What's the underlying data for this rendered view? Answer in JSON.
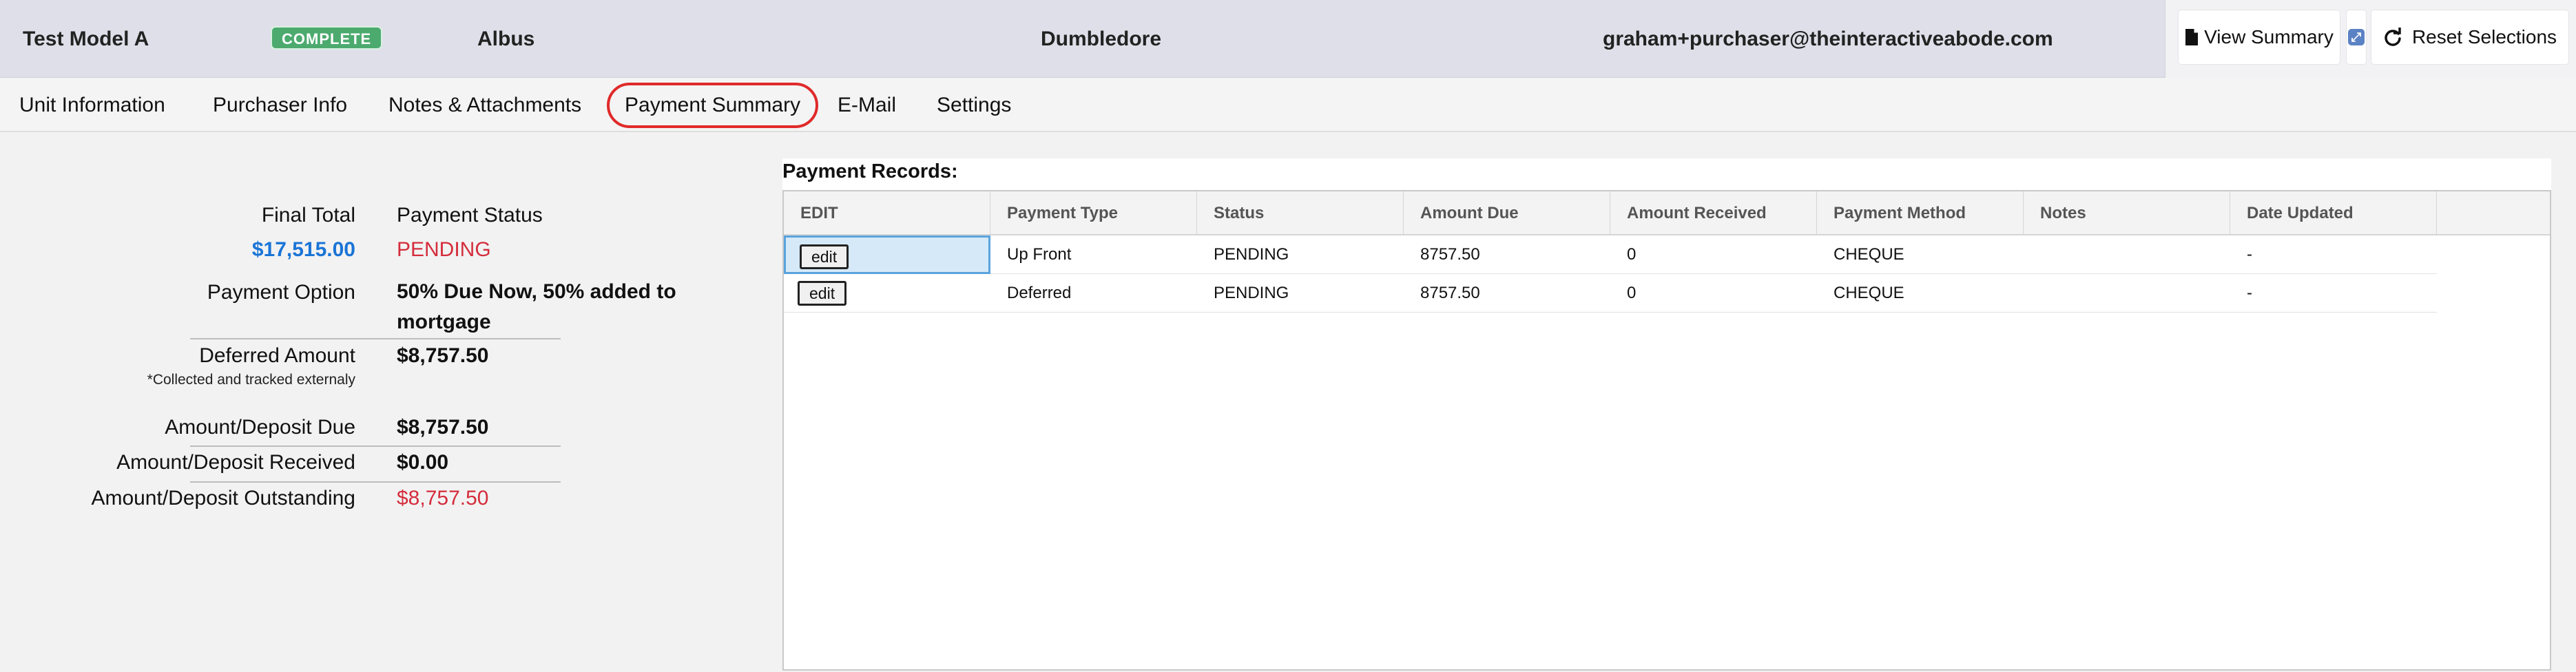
{
  "header": {
    "model_name": "Test Model A",
    "status_badge": "COMPLETE",
    "first_name": "Albus",
    "last_name": "Dumbledore",
    "email": "graham+purchaser@theinteractiveabode.com",
    "view_summary_label": "View Summary",
    "reset_label": "Reset Selections"
  },
  "tabs": [
    {
      "label": "Unit Information"
    },
    {
      "label": "Purchaser Info"
    },
    {
      "label": "Notes & Attachments"
    },
    {
      "label": "Payment Summary",
      "active": true
    },
    {
      "label": "E-Mail"
    },
    {
      "label": "Settings"
    }
  ],
  "summary": {
    "final_total_label": "Final Total",
    "final_total_value": "$17,515.00",
    "payment_status_label": "Payment Status",
    "payment_status_value": "PENDING",
    "payment_option_label": "Payment Option",
    "payment_option_value": "50% Due Now, 50% added to mortgage",
    "deferred_amount_label": "Deferred Amount",
    "deferred_amount_value": "$8,757.50",
    "deferred_note": "*Collected and tracked externaly",
    "amount_due_label": "Amount/Deposit Due",
    "amount_due_value": "$8,757.50",
    "amount_received_label": "Amount/Deposit Received",
    "amount_received_value": "$0.00",
    "amount_outstanding_label": "Amount/Deposit Outstanding",
    "amount_outstanding_value": "$8,757.50"
  },
  "records": {
    "title": "Payment Records:",
    "columns": [
      "EDIT",
      "Payment Type",
      "Status",
      "Amount Due",
      "Amount Received",
      "Payment Method",
      "Notes",
      "Date Updated"
    ],
    "rows": [
      {
        "edit": "edit",
        "payment_type": "Up Front",
        "status": "PENDING",
        "amount_due": "8757.50",
        "amount_received": "0",
        "payment_method": "CHEQUE",
        "notes": "",
        "date_updated": "-"
      },
      {
        "edit": "edit",
        "payment_type": "Deferred",
        "status": "PENDING",
        "amount_due": "8757.50",
        "amount_received": "0",
        "payment_method": "CHEQUE",
        "notes": "",
        "date_updated": "-"
      }
    ]
  },
  "colors": {
    "header_bg": "#dfdfe9",
    "badge_green": "#4caa6e",
    "total_blue": "#1a74d6",
    "pending_red": "#d42d3c",
    "active_tab_outline": "#e02a2a"
  },
  "icons": {
    "view_summary": "document-icon",
    "expand": "expand-icon",
    "reset": "refresh-icon"
  }
}
